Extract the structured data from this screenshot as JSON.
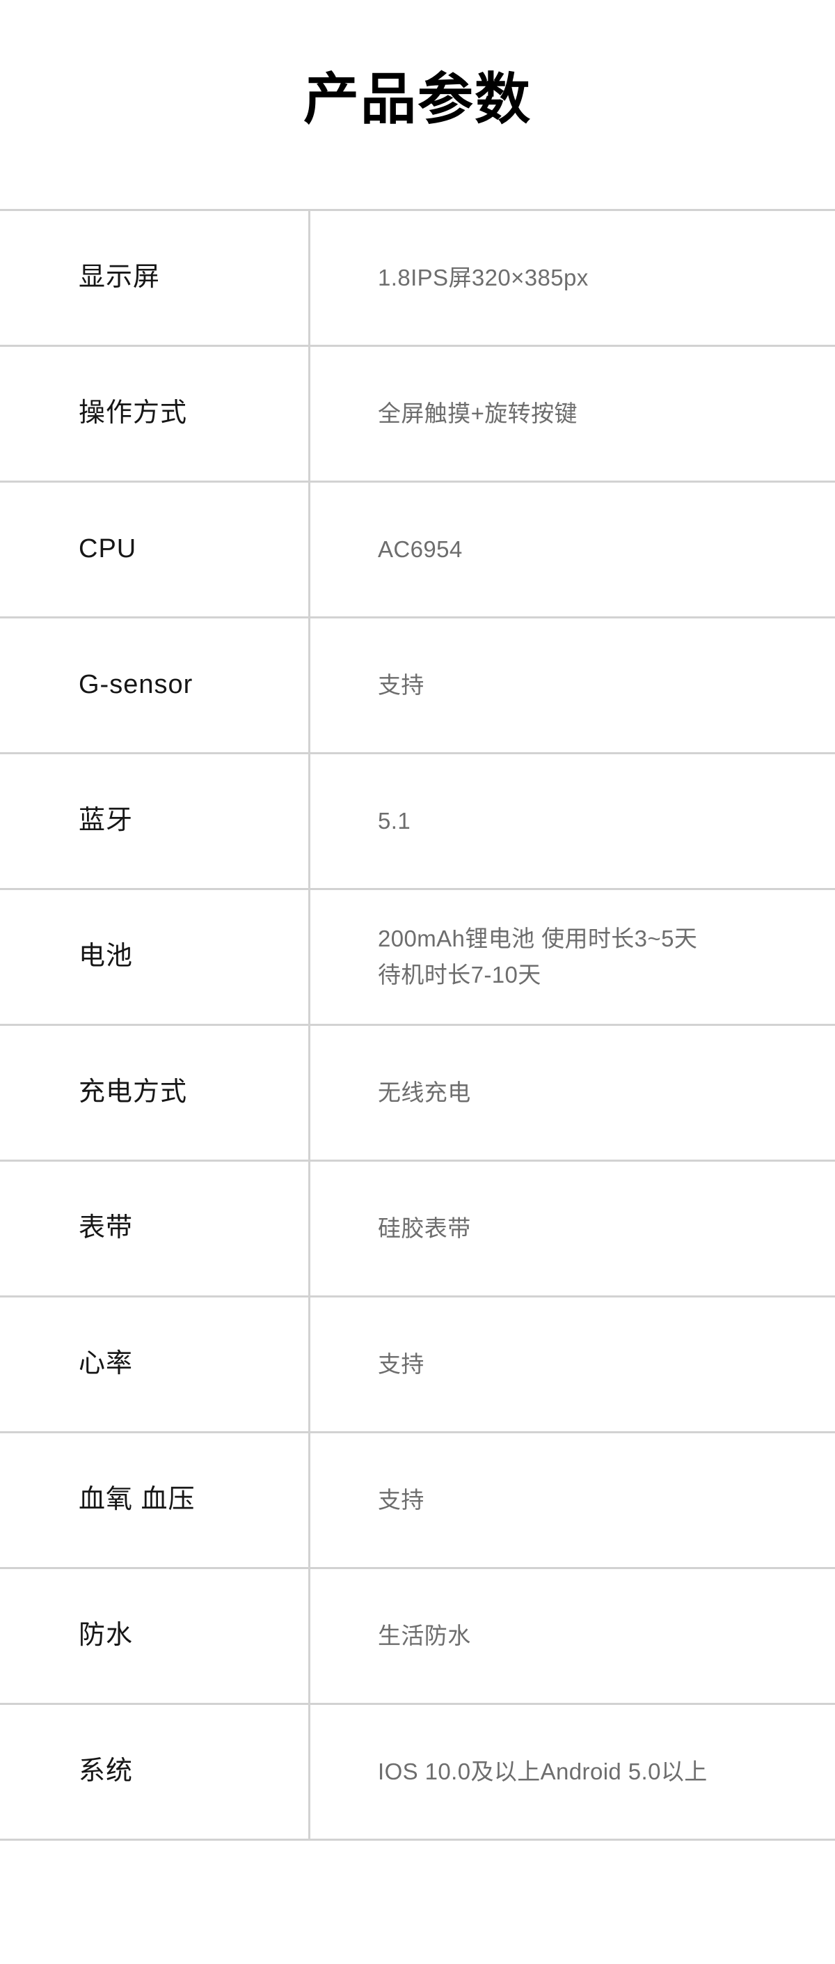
{
  "page": {
    "title": "产品参数",
    "background_color": "#ffffff",
    "title_color": "#000000",
    "label_color": "#161616",
    "value_color": "#6d6d6d",
    "rule_color": "#d2d2d2"
  },
  "spec_table": {
    "rows": [
      {
        "label": "显示屏",
        "value_lines": [
          "1.8IPS屏320×385px"
        ]
      },
      {
        "label": "操作方式",
        "value_lines": [
          "全屏触摸+旋转按键"
        ]
      },
      {
        "label": "CPU",
        "value_lines": [
          "AC6954"
        ]
      },
      {
        "label": "G-sensor",
        "value_lines": [
          "支持"
        ]
      },
      {
        "label": "蓝牙",
        "value_lines": [
          "5.1"
        ]
      },
      {
        "label": "电池",
        "value_lines": [
          "200mAh锂电池 使用时长3~5天",
          "待机时长7-10天"
        ]
      },
      {
        "label": "充电方式",
        "value_lines": [
          "无线充电"
        ]
      },
      {
        "label": "表带",
        "value_lines": [
          "硅胶表带"
        ]
      },
      {
        "label": "心率",
        "value_lines": [
          "支持"
        ]
      },
      {
        "label": "血氧 血压",
        "value_lines": [
          "支持"
        ]
      },
      {
        "label": "防水",
        "value_lines": [
          "生活防水"
        ]
      },
      {
        "label": "系统",
        "value_lines": [
          "IOS 10.0及以上Android 5.0以上"
        ]
      }
    ]
  }
}
